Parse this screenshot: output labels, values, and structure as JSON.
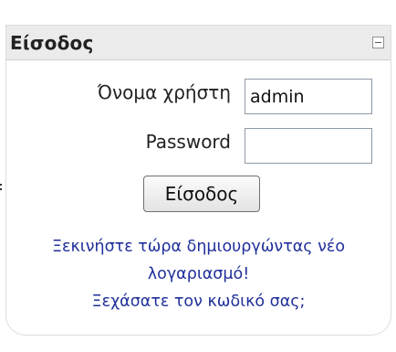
{
  "login_block": {
    "title": "Είσοδος",
    "collapse_icon": "minus-box-icon",
    "username_label": "Όνομα χρήστη",
    "username_value": "admin",
    "password_label": "Password",
    "password_value": "",
    "login_button": "Είσοδος",
    "signup_link_line1": "Ξεκινήστε τώρα δημιουργώντας νέο",
    "signup_link_line2": "λογαριασμό!",
    "forgot_password_link": "Ξεχάσατε τον κωδικό σας;"
  },
  "colors": {
    "header_background": "#ebebeb",
    "link": "#1f2f9a",
    "border": "#dddddd"
  }
}
